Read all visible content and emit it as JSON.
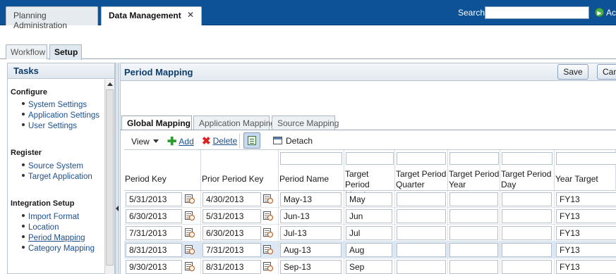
{
  "top": {
    "tabs": [
      {
        "label": "Planning Administration"
      },
      {
        "label": "Data Management",
        "close": "✕"
      }
    ],
    "search_label": "Search",
    "search_value": "",
    "go_icon": "go-arrow-icon",
    "trailing_text": "Ac"
  },
  "subtabs": [
    "Workflow",
    "Setup"
  ],
  "tasks": {
    "title": "Tasks",
    "groups": [
      {
        "title": "Configure",
        "items": [
          "System Settings",
          "Application Settings",
          "User Settings"
        ]
      },
      {
        "title": "Register",
        "items": [
          "Source System",
          "Target Application"
        ]
      },
      {
        "title": "Integration Setup",
        "items": [
          "Import Format",
          "Location",
          "Period Mapping",
          "Category Mapping"
        ]
      }
    ]
  },
  "panel": {
    "title": "Period Mapping",
    "save": "Save",
    "cancel": "Canc"
  },
  "inner_tabs": [
    "Global Mapping",
    "Application Mapping",
    "Source Mapping"
  ],
  "toolbar": {
    "view": "View",
    "add": "Add",
    "delete": "Delete",
    "detach": "Detach"
  },
  "table": {
    "headers": [
      [
        "Period Key"
      ],
      [
        "Prior Period Key"
      ],
      [
        "Period Name"
      ],
      [
        "Target Period",
        "Month"
      ],
      [
        "Target Period",
        "Quarter"
      ],
      [
        "Target Period",
        "Year"
      ],
      [
        "Target Period",
        "Day"
      ],
      [
        "Year Target"
      ]
    ],
    "rows": [
      [
        "5/31/2013",
        "4/30/2013",
        "May-13",
        "May",
        "",
        "",
        "",
        "FY13"
      ],
      [
        "6/30/2013",
        "5/31/2013",
        "Jun-13",
        "Jun",
        "",
        "",
        "",
        "FY13"
      ],
      [
        "7/31/2013",
        "6/30/2013",
        "Jul-13",
        "Jul",
        "",
        "",
        "",
        "FY13"
      ],
      [
        "8/31/2013",
        "7/31/2013",
        "Aug-13",
        "Aug",
        "",
        "",
        "",
        "FY13"
      ],
      [
        "9/30/2013",
        "8/31/2013",
        "Sep-13",
        "Sep",
        "",
        "",
        "",
        "FY13"
      ]
    ],
    "selected_row": 3
  }
}
